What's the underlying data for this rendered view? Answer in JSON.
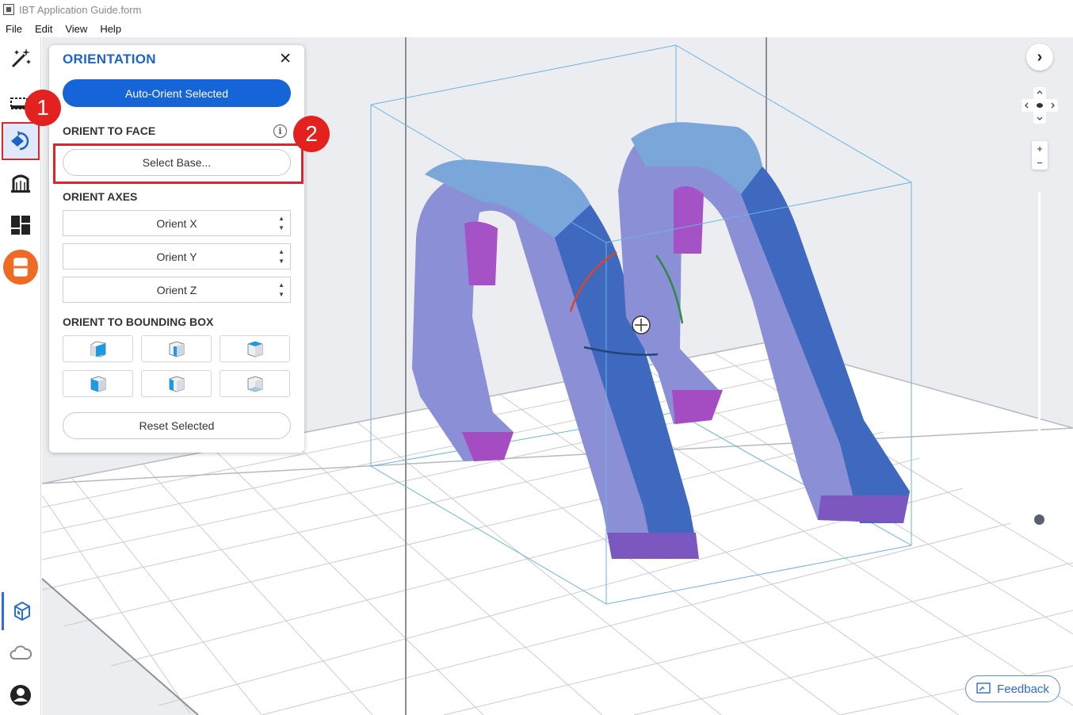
{
  "window": {
    "title": "IBT Application Guide.form"
  },
  "menu": [
    "File",
    "Edit",
    "View",
    "Help"
  ],
  "toolbar": {
    "tools": [
      "magic-wand-icon",
      "select-box-icon",
      "orientation-icon",
      "supports-icon",
      "layout-icon",
      "print-icon"
    ],
    "bottom": [
      "model-view-icon",
      "cloud-icon",
      "account-icon"
    ]
  },
  "panel": {
    "title": "ORIENTATION",
    "close": "✕",
    "auto_orient": "Auto-Orient Selected",
    "orient_to_face": "ORIENT TO FACE",
    "select_base": "Select Base...",
    "orient_axes": "ORIENT AXES",
    "axes": [
      "Orient X",
      "Orient Y",
      "Orient Z"
    ],
    "orient_to_bbox": "ORIENT TO BOUNDING BOX",
    "reset": "Reset Selected"
  },
  "badges": [
    "1",
    "2"
  ],
  "nav": {
    "next": "›"
  },
  "zoom": {
    "plus": "+",
    "minus": "−"
  },
  "feedback": "Feedback",
  "colors": {
    "accent": "#1565d8",
    "highlight": "#d8262b",
    "model_light": "#8a8fd6",
    "model_dark": "#3b6bc0",
    "model_magenta": "#b24fc8"
  }
}
